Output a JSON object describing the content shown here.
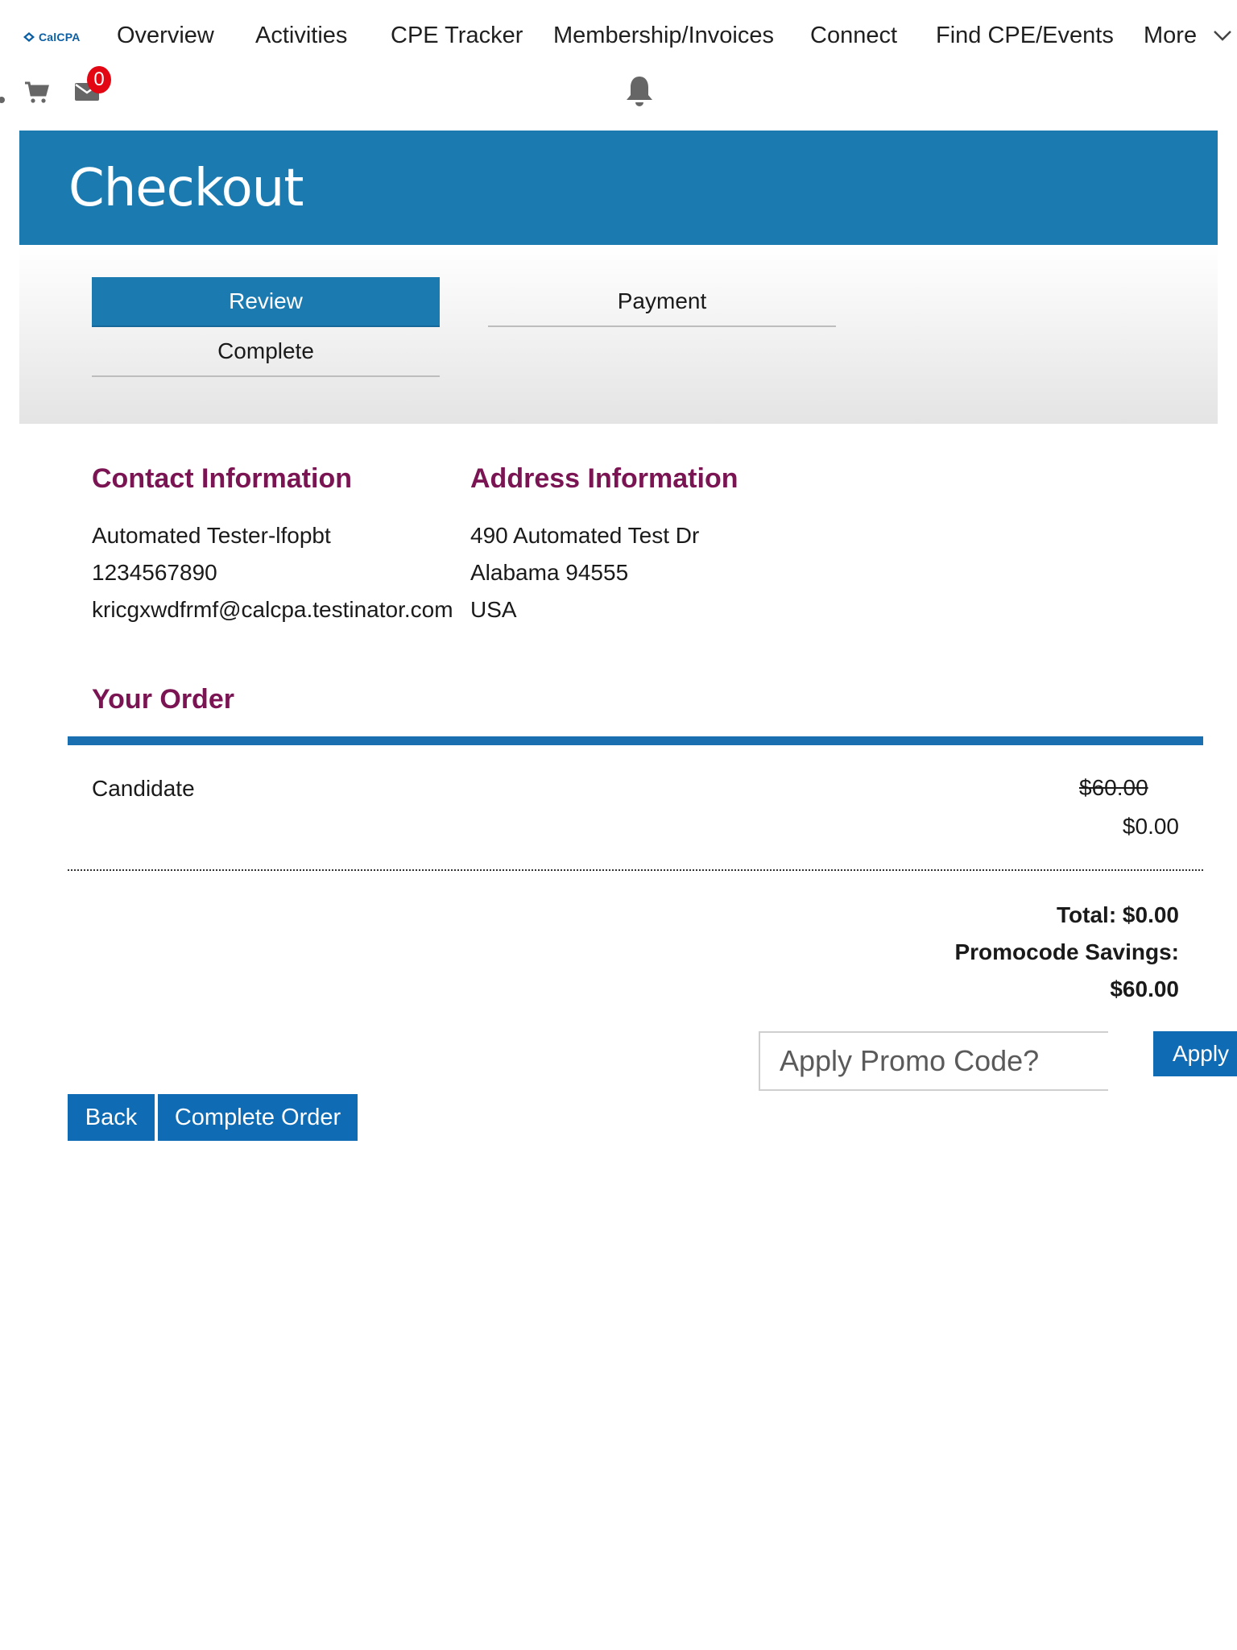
{
  "nav": {
    "logo_text": "CalCPA",
    "items": [
      {
        "label": "Overview"
      },
      {
        "label": "Activities"
      },
      {
        "label": "CPE Tracker"
      },
      {
        "label": "Membership/Invoices"
      },
      {
        "label": "Connect"
      },
      {
        "label": "Find CPE/Events"
      },
      {
        "label": "More"
      }
    ],
    "message_count": "0"
  },
  "page": {
    "title": "Checkout"
  },
  "steps": [
    {
      "label": "Review",
      "active": true
    },
    {
      "label": "Payment",
      "active": false
    },
    {
      "label": "Complete",
      "active": false
    }
  ],
  "contact": {
    "heading": "Contact Information",
    "name": "Automated  Tester-lfopbt",
    "phone": "1234567890",
    "email": "kricgxwdfrmf@calcpa.testinator.com"
  },
  "address": {
    "heading": "Address Information",
    "street": "490 Automated Test Dr",
    "state_zip": "Alabama 94555",
    "country": "USA"
  },
  "order": {
    "heading": "Your Order",
    "items": [
      {
        "name": "Candidate",
        "original_price": "$60.00",
        "price": "$0.00"
      }
    ],
    "total": "Total: $0.00",
    "savings_label": "Promocode Savings:",
    "savings_value": "$60.00"
  },
  "promo": {
    "placeholder": "Apply Promo Code?",
    "value": "",
    "apply_label": "Apply"
  },
  "actions": {
    "back_label": "Back",
    "complete_label": "Complete Order"
  },
  "colors": {
    "brand_blue": "#1b7bb1",
    "button_blue": "#0f6cb4",
    "heading_maroon": "#7b1452",
    "badge_red": "#e30613"
  }
}
